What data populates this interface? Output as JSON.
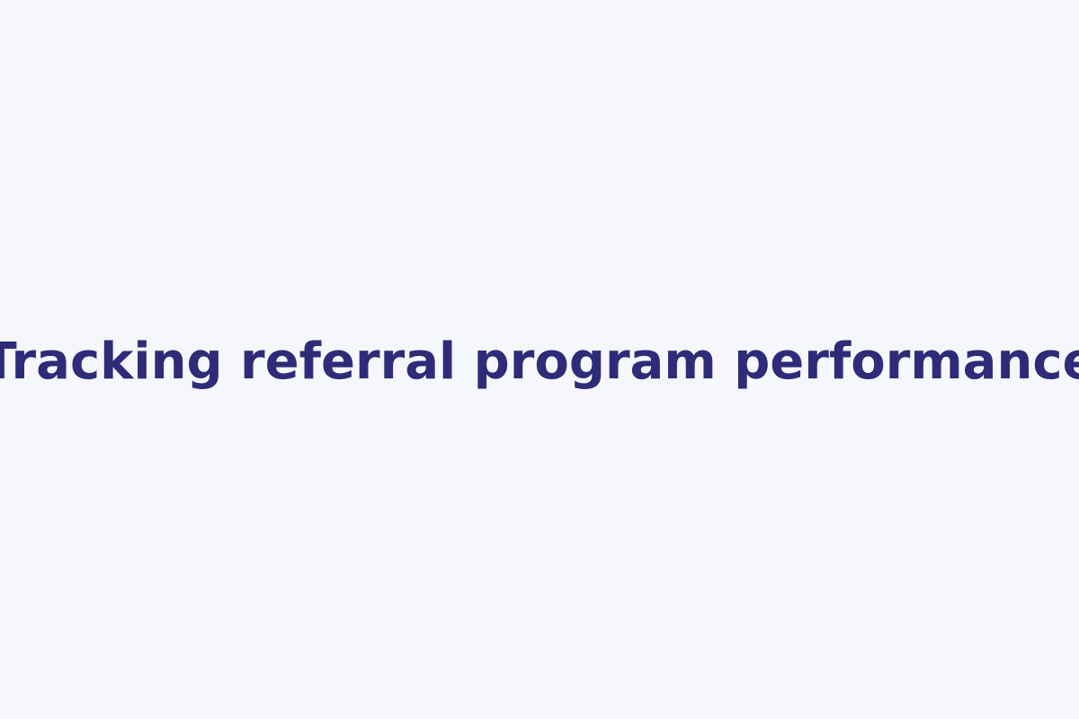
{
  "headline": "Tracking referral program performance",
  "colors": {
    "background": "#F5F7FC",
    "text": "#2E2C78"
  }
}
